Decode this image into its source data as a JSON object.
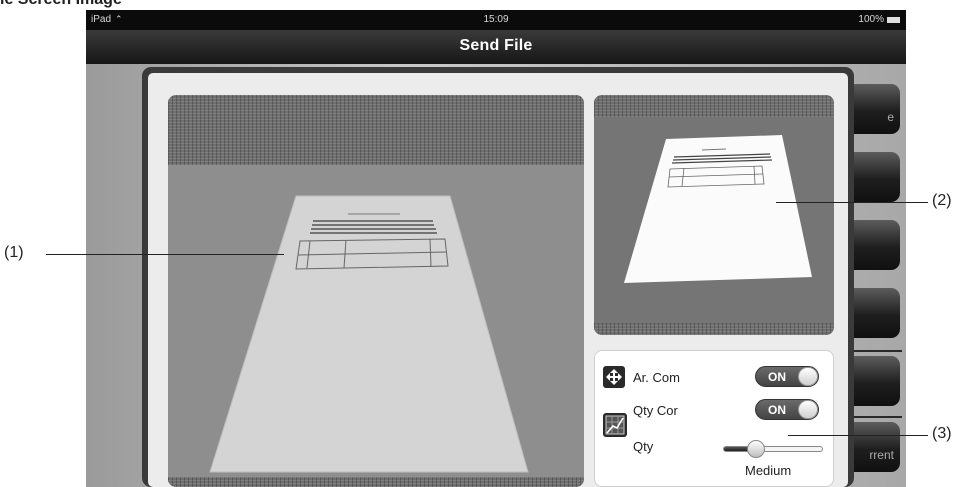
{
  "doc_title_fragment": "le Screen Image",
  "status_bar": {
    "device": "iPad",
    "time": "15:09",
    "battery": "100%"
  },
  "nav": {
    "title": "Send File"
  },
  "side_buttons": [
    {
      "label": "e"
    },
    {
      "label": ""
    },
    {
      "label": ""
    },
    {
      "label": ""
    },
    {
      "label": ""
    },
    {
      "label": "rrent"
    }
  ],
  "settings": {
    "area_compensation": {
      "label": "Ar. Com",
      "state": "ON",
      "icon": "area-compensation-icon"
    },
    "quality_correction": {
      "label": "Qty Cor",
      "state": "ON",
      "icon": "quality-correction-icon"
    },
    "quality": {
      "label": "Qty",
      "value": "Medium",
      "level": 0.33
    }
  },
  "callouts": {
    "one": "(1)",
    "two": "(2)",
    "three": "(3)"
  }
}
